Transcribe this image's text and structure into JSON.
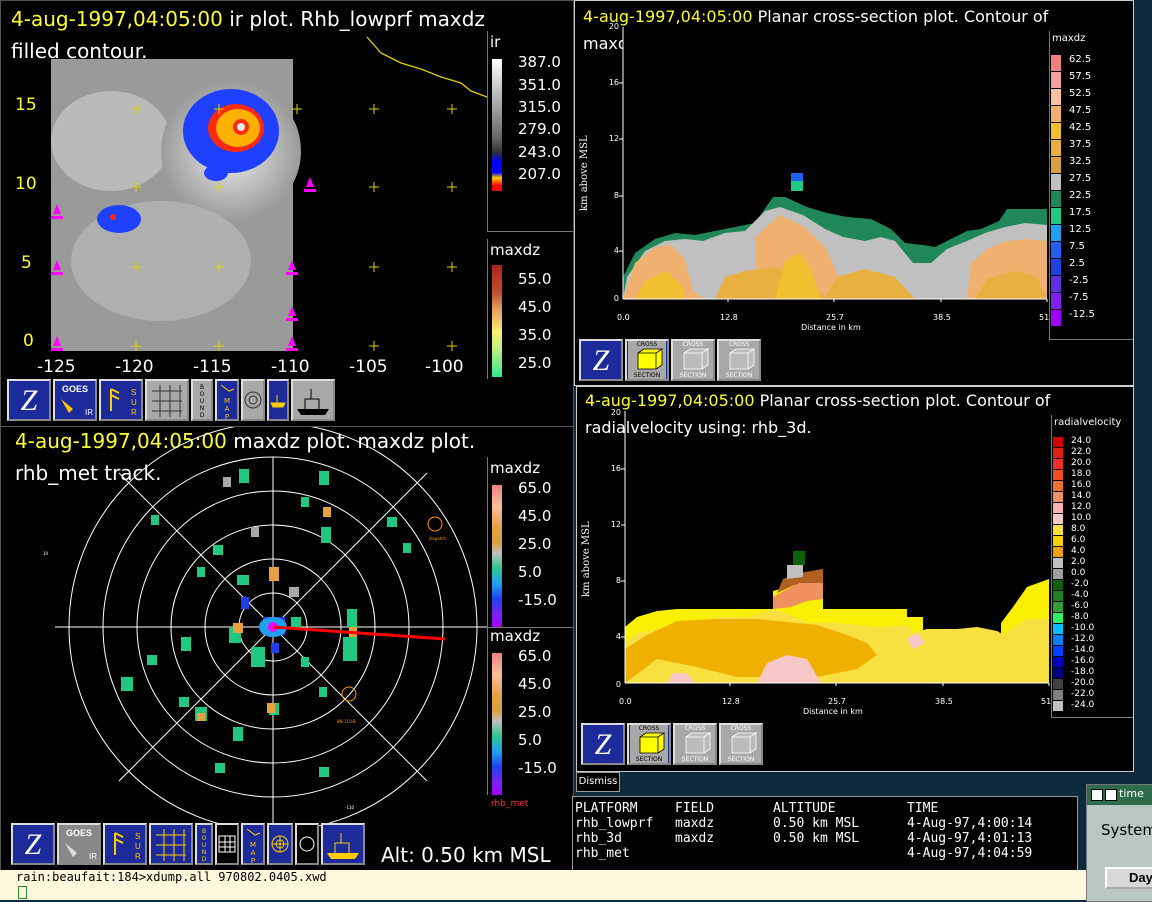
{
  "ir_window": {
    "date": "4-aug-1997,04:05:00",
    "title_rest": " ir plot.  Rhb_lowprf maxdz",
    "title_line2": "filled contour.",
    "y_ticks": [
      "15",
      "10",
      "5",
      "0"
    ],
    "x_ticks": [
      "-125",
      "-120",
      "-115",
      "-110",
      "-105",
      "-100"
    ],
    "legend_ir_title": "ir",
    "legend_ir": [
      {
        "label": "387.0",
        "color": "#ffffff"
      },
      {
        "label": "351.0",
        "color": "#d8d8d8"
      },
      {
        "label": "315.0",
        "color": "#a8a8a8"
      },
      {
        "label": "279.0",
        "color": "#707070"
      },
      {
        "label": "243.0",
        "color": "#0000ff"
      },
      {
        "label": "207.0",
        "color": "#ff3300"
      }
    ],
    "legend_dz_title": "maxdz",
    "legend_dz": [
      {
        "label": "55.0",
        "color": "#b84020"
      },
      {
        "label": "45.0",
        "color": "#e8a060"
      },
      {
        "label": "35.0",
        "color": "#f8f070"
      },
      {
        "label": "25.0",
        "color": "#30e890"
      }
    ],
    "toolbar": [
      "Z",
      "GOES IR",
      "SUR",
      "GRID",
      "BOUNDS",
      "MAP",
      "CIRCLE",
      "SHIP"
    ]
  },
  "cs1_window": {
    "date": "4-aug-1997,04:05:00",
    "title_rest": "  Planar cross-section plot.  Contour of",
    "title_line2": "maxdz using: rhb_3d.",
    "ylabel": "km above MSL",
    "xlabel": "Distance in km",
    "y_ticks": [
      "0",
      "4",
      "8",
      "12",
      "16"
    ],
    "x_ticks": [
      "0.0",
      "12.8",
      "25.7",
      "38.5",
      "51"
    ],
    "legend_title": "maxdz",
    "legend": [
      {
        "label": "62.5",
        "color": "#f08080"
      },
      {
        "label": "57.5",
        "color": "#f4a0a0"
      },
      {
        "label": "52.5",
        "color": "#f8c0a0"
      },
      {
        "label": "47.5",
        "color": "#f0b070"
      },
      {
        "label": "42.5",
        "color": "#f0c030"
      },
      {
        "label": "37.5",
        "color": "#e8b040"
      },
      {
        "label": "32.5",
        "color": "#d8a040"
      },
      {
        "label": "27.5",
        "color": "#c0c0c0"
      },
      {
        "label": "22.5",
        "color": "#208858"
      },
      {
        "label": "17.5",
        "color": "#20c880"
      },
      {
        "label": "12.5",
        "color": "#20a0f0"
      },
      {
        "label": "7.5",
        "color": "#2060f0"
      },
      {
        "label": "2.5",
        "color": "#2040e0"
      },
      {
        "label": "-2.5",
        "color": "#6030e0"
      },
      {
        "label": "-7.5",
        "color": "#8020f0"
      },
      {
        "label": "-12.5",
        "color": "#a000ff"
      }
    ],
    "buttons": [
      {
        "top": "CROSS",
        "bottom": "SECTION"
      },
      {
        "top": "CROSS",
        "bottom": "SECTION"
      },
      {
        "top": "CROSS",
        "bottom": "SECTION"
      }
    ]
  },
  "cs2_window": {
    "date": "4-aug-1997,04:05:00",
    "title_rest": "  Planar cross-section plot.  Contour of",
    "title_line2": "radialvelocity using: rhb_3d.",
    "ylabel": "km above MSL",
    "xlabel": "Distance in km",
    "y_ticks": [
      "0",
      "4",
      "8",
      "12",
      "16",
      "20"
    ],
    "x_ticks": [
      "0.0",
      "12.8",
      "25.7",
      "38.5",
      "51"
    ],
    "legend_title": "radialvelocity",
    "legend": [
      {
        "label": "24.0",
        "color": "#d00000"
      },
      {
        "label": "22.0",
        "color": "#e02010"
      },
      {
        "label": "20.0",
        "color": "#f03020"
      },
      {
        "label": "18.0",
        "color": "#f05020"
      },
      {
        "label": "16.0",
        "color": "#f07030"
      },
      {
        "label": "14.0",
        "color": "#f09060"
      },
      {
        "label": "12.0",
        "color": "#f8b0b0"
      },
      {
        "label": "10.0",
        "color": "#f8c8c8"
      },
      {
        "label": "8.0",
        "color": "#f8e040"
      },
      {
        "label": "6.0",
        "color": "#f8d000"
      },
      {
        "label": "4.0",
        "color": "#f0a000"
      },
      {
        "label": "2.0",
        "color": "#c0c0c0"
      },
      {
        "label": "0.0",
        "color": "#a0a0a0"
      },
      {
        "label": "-2.0",
        "color": "#106010"
      },
      {
        "label": "-4.0",
        "color": "#208020"
      },
      {
        "label": "-6.0",
        "color": "#30a030"
      },
      {
        "label": "-8.0",
        "color": "#30f060"
      },
      {
        "label": "-10.0",
        "color": "#00c0ff"
      },
      {
        "label": "-12.0",
        "color": "#0080ff"
      },
      {
        "label": "-14.0",
        "color": "#0040ff"
      },
      {
        "label": "-16.0",
        "color": "#0000c0"
      },
      {
        "label": "-18.0",
        "color": "#000080"
      },
      {
        "label": "-20.0",
        "color": "#404040"
      },
      {
        "label": "-22.0",
        "color": "#808080"
      },
      {
        "label": "-24.0",
        "color": "#c0c0c0"
      }
    ],
    "buttons": [
      {
        "top": "CROSS",
        "bottom": "SECTION"
      },
      {
        "top": "CROSS",
        "bottom": "SECTION"
      },
      {
        "top": "CROSS",
        "bottom": "SECTION"
      }
    ],
    "dismiss_label": "Dismiss"
  },
  "radar_window": {
    "date": "4-aug-1997,04:05:00",
    "title_rest": "  maxdz plot.  maxdz plot.",
    "title_line2": "rhb_met track.",
    "legend1_title": "maxdz",
    "legend1": [
      {
        "label": "65.0",
        "color": "#f08080"
      },
      {
        "label": "45.0",
        "color": "#e8a040"
      },
      {
        "label": "25.0",
        "color": "#30c890"
      },
      {
        "label": "5.0",
        "color": "#2040f0"
      },
      {
        "label": "-15.0",
        "color": "#a000ff"
      }
    ],
    "legend2_title": "maxdz",
    "legend2": [
      {
        "label": "65.0",
        "color": "#f08080"
      },
      {
        "label": "45.0",
        "color": "#e8a040"
      },
      {
        "label": "25.0",
        "color": "#30c890"
      },
      {
        "label": "5.0",
        "color": "#2040f0"
      },
      {
        "label": "-15.0",
        "color": "#a000ff"
      }
    ],
    "track_label": "rhb_met",
    "small_marks": [
      "10",
      "-110",
      "dispatch",
      "8N-110-B"
    ],
    "altitude": "Alt: 0.50 km MSL",
    "toolbar": [
      "Z",
      "GOES IR",
      "SUR",
      "GRID",
      "BOUNDS",
      "MAP",
      "CIRCLE",
      "SHIP"
    ]
  },
  "info_table": {
    "headers": [
      "PLATFORM",
      "FIELD",
      "ALTITUDE",
      "TIME"
    ],
    "rows": [
      [
        "rhb_lowprf",
        "maxdz",
        "0.50 km MSL",
        "4-Aug-97,4:00:14"
      ],
      [
        "rhb_3d",
        "maxdz",
        "0.50 km MSL",
        "4-Aug-97,4:01:13"
      ],
      [
        "rhb_met",
        "",
        "",
        "4-Aug-97,4:04:59"
      ]
    ]
  },
  "terminal": {
    "line": "rain:beaufait:184>xdump.all 970802.0405.xwd"
  },
  "side_window": {
    "title": "time",
    "label": "System",
    "button": "Day"
  }
}
